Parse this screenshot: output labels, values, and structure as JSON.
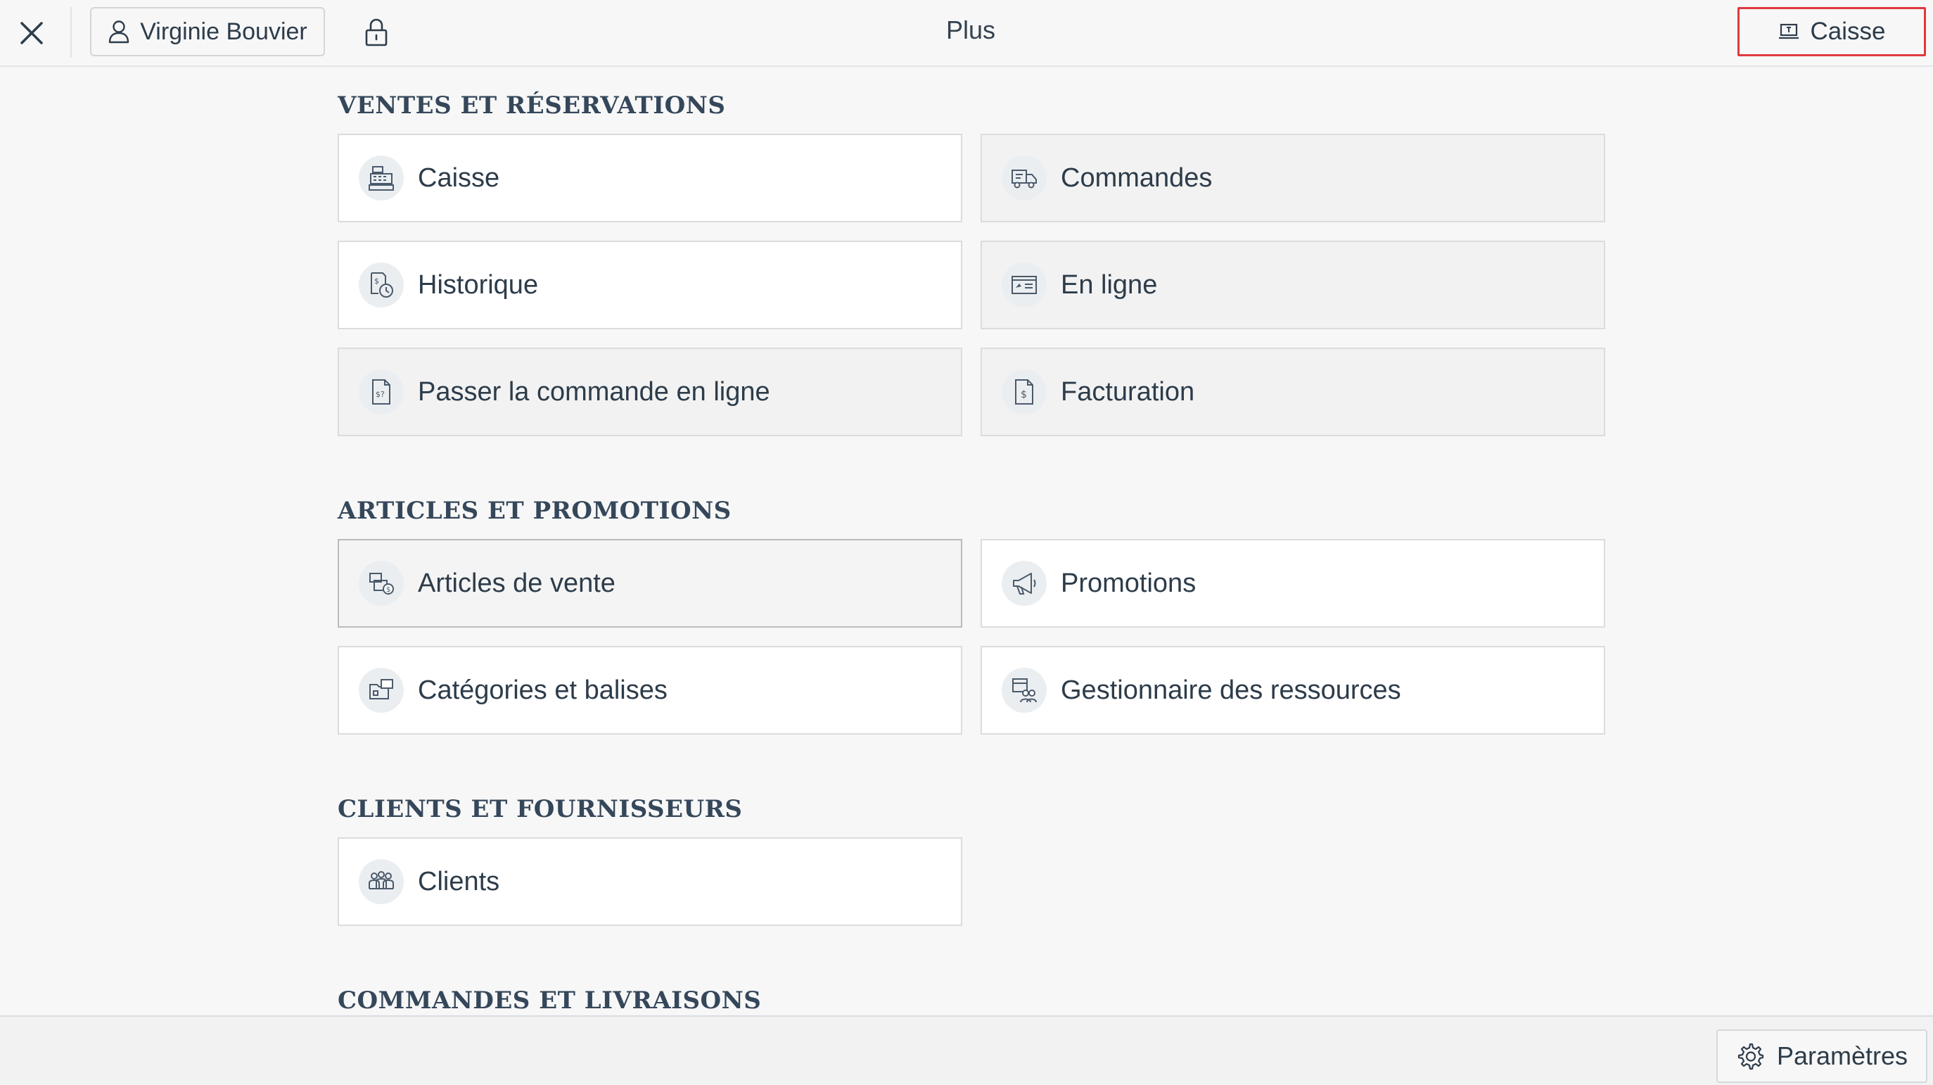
{
  "header": {
    "user_label": "Virginie Bouvier",
    "title": "Plus",
    "register_label": "Caisse",
    "highlight_color": "#e0393e"
  },
  "sections": [
    {
      "title": "VENTES ET RÉSERVATIONS",
      "tiles": [
        {
          "label": "Caisse",
          "icon": "cash-register-icon"
        },
        {
          "label": "Commandes",
          "icon": "delivery-truck-icon"
        },
        {
          "label": "Historique",
          "icon": "receipt-clock-icon"
        },
        {
          "label": "En ligne",
          "icon": "online-card-icon"
        },
        {
          "label": "Passer la commande en ligne",
          "icon": "invoice-document-icon"
        },
        {
          "label": "Facturation",
          "icon": "billing-document-icon"
        }
      ]
    },
    {
      "title": "ARTICLES ET PROMOTIONS",
      "tiles": [
        {
          "label": "Articles de vente",
          "icon": "boxes-price-icon"
        },
        {
          "label": "Promotions",
          "icon": "megaphone-icon"
        },
        {
          "label": "Catégories et balises",
          "icon": "folder-tag-icon"
        },
        {
          "label": "Gestionnaire des ressources",
          "icon": "resources-people-icon"
        }
      ]
    },
    {
      "title": "CLIENTS ET FOURNISSEURS",
      "tiles": [
        {
          "label": "Clients",
          "icon": "customers-group-icon"
        }
      ]
    },
    {
      "title": "COMMANDES ET LIVRAISONS",
      "tiles": []
    }
  ],
  "footer": {
    "settings_label": "Paramètres"
  }
}
